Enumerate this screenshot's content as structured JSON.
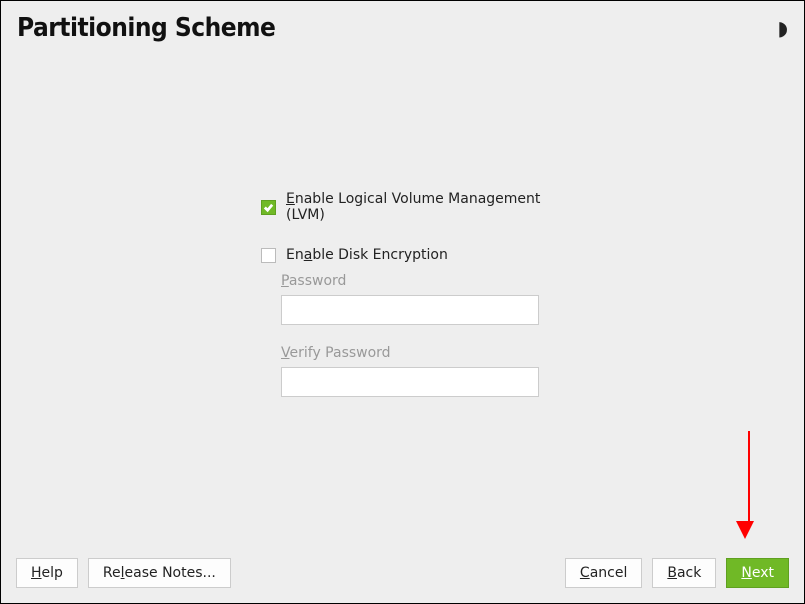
{
  "header": {
    "title": "Partitioning Scheme"
  },
  "options": {
    "lvm": {
      "checked": true,
      "label_pre": "",
      "label_u": "E",
      "label_post": "nable Logical Volume Management (LVM)"
    },
    "encryption": {
      "checked": false,
      "label_pre": "En",
      "label_u": "a",
      "label_post": "ble Disk Encryption"
    }
  },
  "fields": {
    "password": {
      "label_u": "P",
      "label_post": "assword",
      "value": ""
    },
    "verify": {
      "label_u": "V",
      "label_post": "erify Password",
      "value": ""
    }
  },
  "footer": {
    "help_u": "H",
    "help_post": "elp",
    "release_pre": "Re",
    "release_u": "l",
    "release_post": "ease Notes...",
    "cancel_u": "C",
    "cancel_post": "ancel",
    "back_u": "B",
    "back_post": "ack",
    "next_u": "N",
    "next_post": "ext"
  },
  "colors": {
    "accent": "#70b926",
    "arrow": "#ff0000"
  }
}
